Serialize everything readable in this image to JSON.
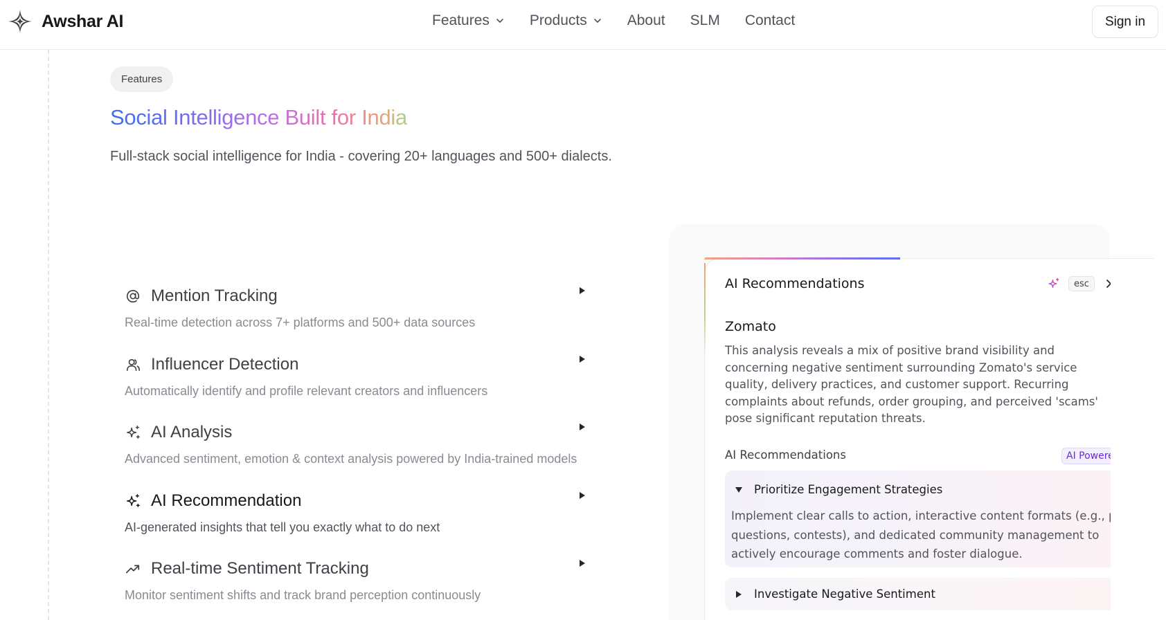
{
  "header": {
    "brand_name": "Awshar AI",
    "nav": [
      {
        "label": "Features",
        "has_dropdown": true
      },
      {
        "label": "Products",
        "has_dropdown": true
      },
      {
        "label": "About",
        "has_dropdown": false
      },
      {
        "label": "SLM",
        "has_dropdown": false
      },
      {
        "label": "Contact",
        "has_dropdown": false
      }
    ],
    "signin_label": "Sign in"
  },
  "hero": {
    "pill": "Features",
    "title": "Social Intelligence Built for India",
    "subtitle": "Full-stack social intelligence for India - covering 20+ languages and 500+ dialects."
  },
  "features": [
    {
      "icon": "at-sign-icon",
      "title": "Mention Tracking",
      "description": "Real-time detection across 7+ platforms and 500+ data sources"
    },
    {
      "icon": "users-icon",
      "title": "Influencer Detection",
      "description": "Automatically identify and profile relevant creators and influencers"
    },
    {
      "icon": "sparkles-icon",
      "title": "AI Analysis",
      "description": "Advanced sentiment, emotion & context analysis powered by India-trained models"
    },
    {
      "icon": "sparkles-icon",
      "title": "AI Recommendation",
      "description": "AI-generated insights that tell you exactly what to do next",
      "active": true
    },
    {
      "icon": "trending-up-icon",
      "title": "Real-time Sentiment Tracking",
      "description": "Monitor sentiment shifts and track brand perception continuously"
    }
  ],
  "card": {
    "title": "AI Recommendations",
    "esc_label": "esc",
    "company": "Zomato",
    "analysis": "This analysis reveals a mix of positive brand visibility and concerning negative sentiment surrounding Zomato's service quality, delivery practices, and customer support. Recurring complaints about refunds, order grouping, and perceived 'scams' pose significant reputation threats.",
    "recommendations_label": "AI Recommendations",
    "badge": "AI Powered",
    "items": [
      {
        "title": "Prioritize Engagement Strategies",
        "expanded": true,
        "body": "Implement clear calls to action, interactive content formats (e.g., polls, questions, contests), and dedicated community management to actively encourage comments and foster dialogue."
      },
      {
        "title": "Investigate Negative Sentiment",
        "expanded": false
      }
    ]
  },
  "colors": {
    "accent_purple": "#6d28d9",
    "title_gradient": [
      "#3b6ef0",
      "#c06ee6",
      "#ec6fa8",
      "#a7d28a"
    ]
  }
}
